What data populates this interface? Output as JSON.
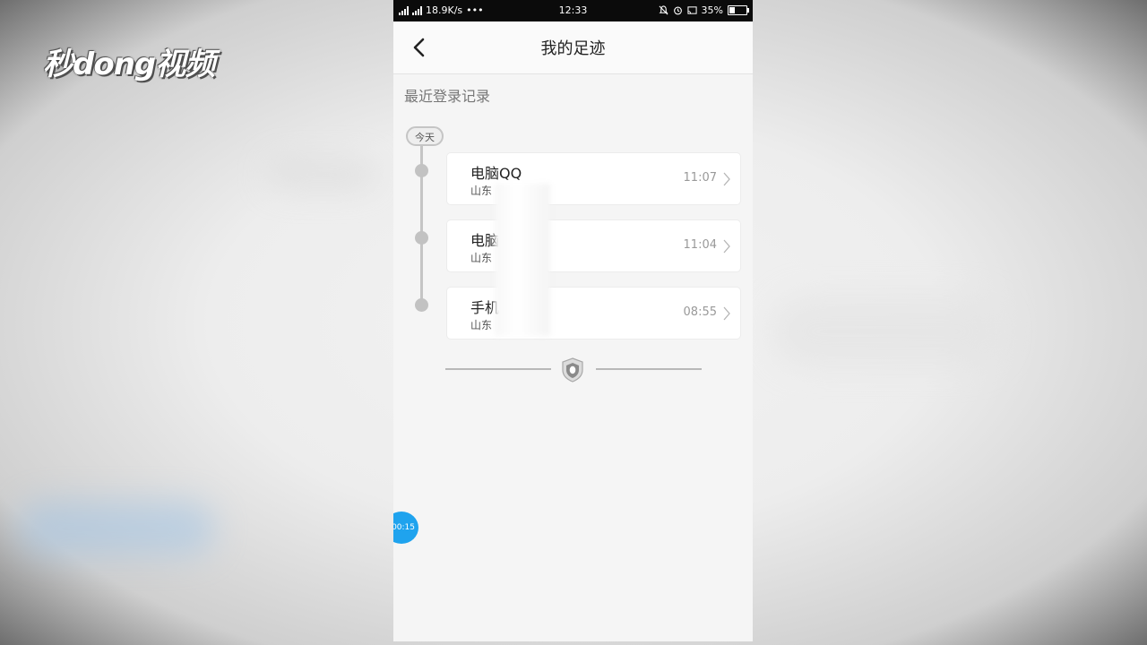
{
  "watermark": {
    "logo_text": "秒dong视频"
  },
  "statusbar": {
    "network_speed": "18.9K/s",
    "more": "•••",
    "time": "12:33",
    "battery_percent": "35%",
    "battery_level": 0.35,
    "icons": [
      "signal-icon",
      "signal-icon",
      "mute-icon",
      "alarm-icon",
      "cast-icon",
      "battery-icon"
    ]
  },
  "header": {
    "title": "我的足迹",
    "back_icon": "chevron-left-icon"
  },
  "section": {
    "title": "最近登录记录"
  },
  "timeline": {
    "badge": "今天",
    "entries": [
      {
        "name": "电脑QQ",
        "location": "山东",
        "time": "11:07"
      },
      {
        "name": "电脑",
        "location": "山东",
        "time": "11:04"
      },
      {
        "name": "手机",
        "location": "山东",
        "time": "08:55"
      }
    ]
  },
  "footer": {
    "icon": "qq-shield-icon"
  },
  "floating_button": {
    "label": "00:15"
  },
  "colors": {
    "accent": "#1fa3ee",
    "timeline": "#c5c5c5"
  }
}
